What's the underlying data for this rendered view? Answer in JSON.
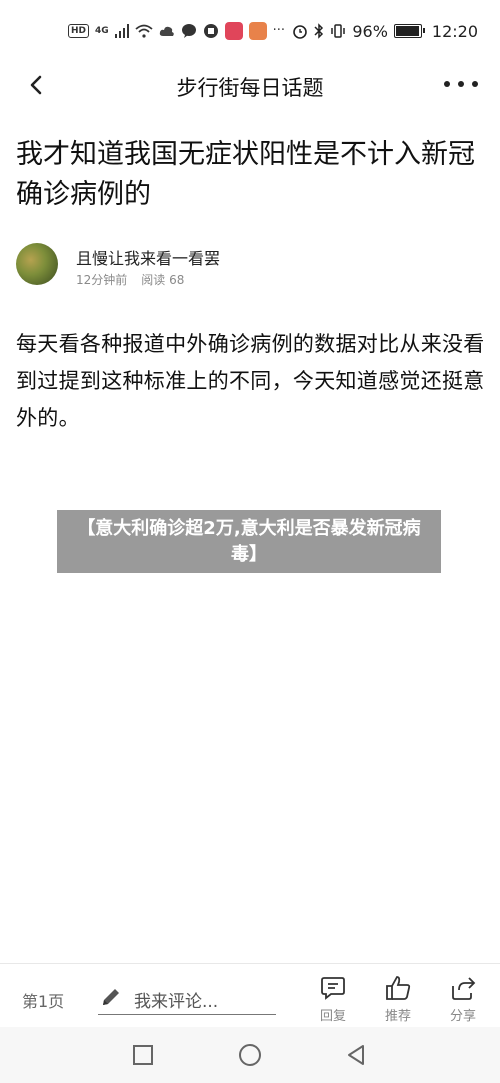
{
  "status_bar": {
    "hd_badge": "HD",
    "network": "4G",
    "battery_percent": "96%",
    "battery_level": 0.96,
    "time": "12:20"
  },
  "nav": {
    "title": "步行街每日话题"
  },
  "article": {
    "title": "我才知道我国无症状阳性是不计入新冠确诊病例的",
    "author": "且慢让我来看一看罢",
    "time_ago": "12分钟前",
    "read_count": "阅读 68",
    "body": "每天看各种报道中外确诊病例的数据对比从来没看到过提到这种标准上的不同，今天知道感觉还挺意外的。"
  },
  "overlay": {
    "text": "【意大利确诊超2万,意大利是否暴发新冠病毒】"
  },
  "bottom_bar": {
    "page": "第1页",
    "comment_placeholder": "我来评论...",
    "reply_label": "回复",
    "recommend_label": "推荐",
    "share_label": "分享"
  },
  "colors": {
    "overlay_bg": "#9a9a9a",
    "muted_text": "#888888"
  }
}
